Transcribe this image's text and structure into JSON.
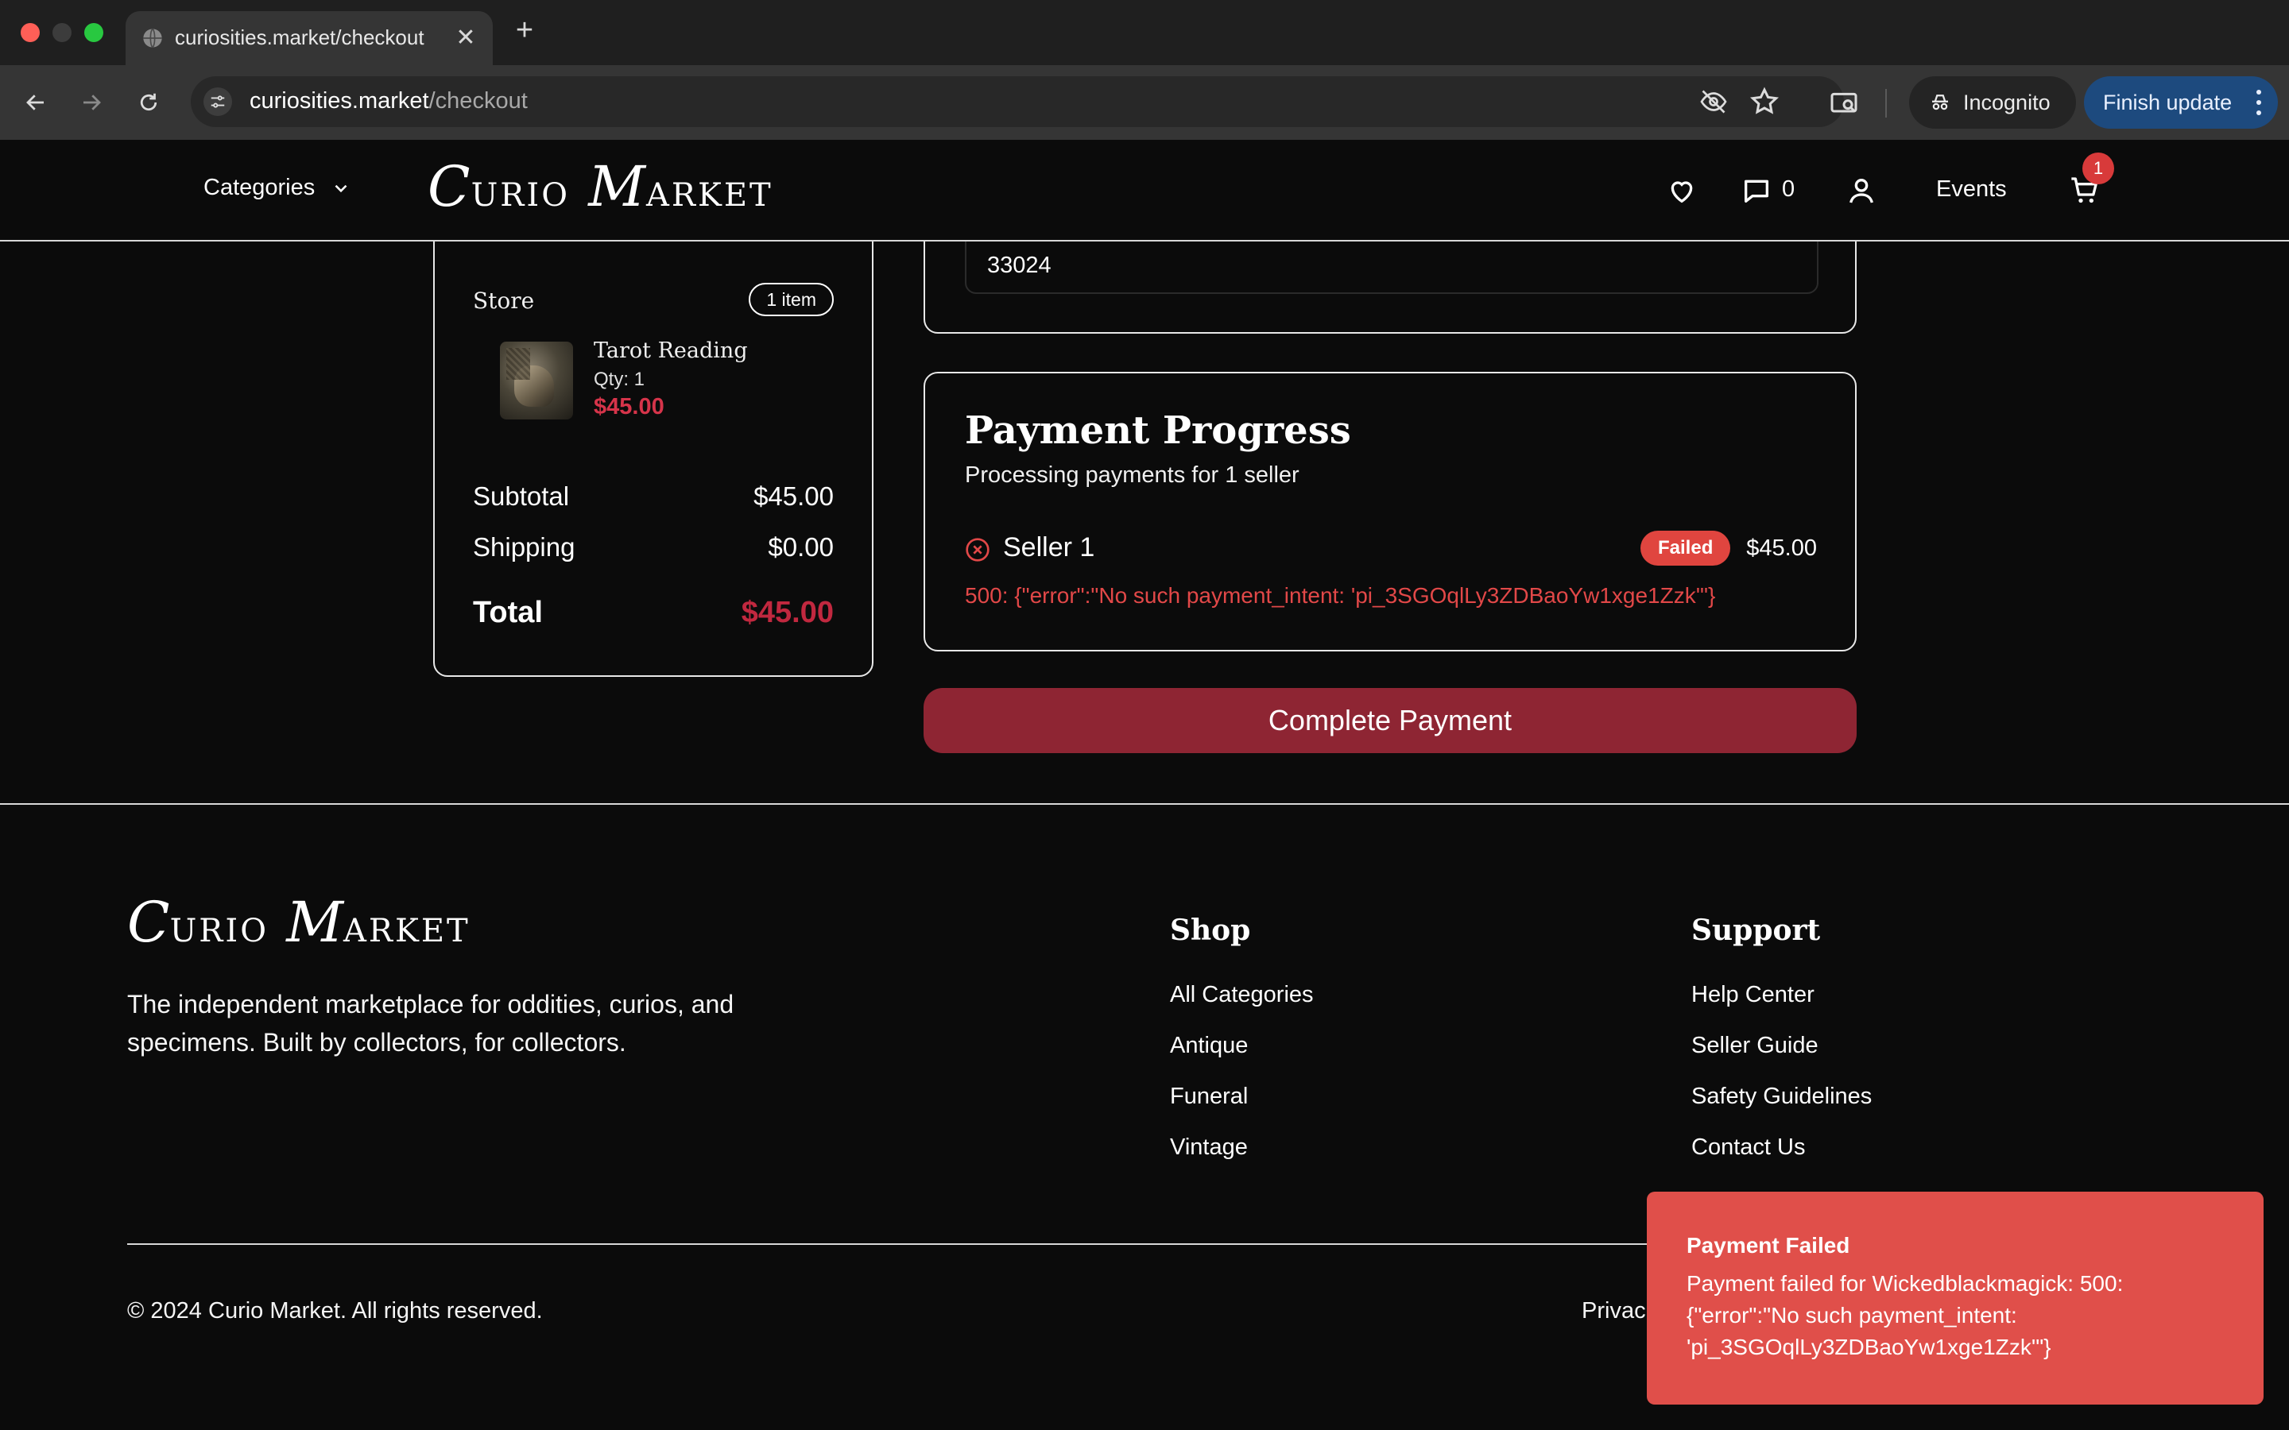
{
  "browser": {
    "tab_title": "curiosities.market/checkout",
    "tab_close": "✕",
    "new_tab": "+",
    "url_host": "curiosities.market",
    "url_path": "/checkout",
    "incognito_label": "Incognito",
    "finish_update_label": "Finish update"
  },
  "header": {
    "categories_label": "Categories",
    "logo_first_initial": "C",
    "logo_first_rest": "URIO",
    "logo_second_initial": "M",
    "logo_second_rest": "ARKET",
    "messages_count": "0",
    "events_label": "Events",
    "cart_count": "1"
  },
  "summary": {
    "store_label": "Store",
    "item_count": "1 item",
    "item": {
      "name": "Tarot Reading",
      "qty": "Qty: 1",
      "price": "$45.00"
    },
    "subtotal_label": "Subtotal",
    "subtotal_value": "$45.00",
    "shipping_label": "Shipping",
    "shipping_value": "$0.00",
    "total_label": "Total",
    "total_value": "$45.00"
  },
  "address": {
    "zip_value": "33024"
  },
  "payment": {
    "title": "Payment Progress",
    "subtitle": "Processing payments for 1 seller",
    "seller_name": "Seller 1",
    "status": "Failed",
    "amount": "$45.00",
    "error": "500: {\"error\":\"No such payment_intent: 'pi_3SGOqlLy3ZDBaoYw1xge1Zzk'\"}",
    "complete_button": "Complete Payment"
  },
  "footer": {
    "logo_first_initial": "C",
    "logo_first_rest": "URIO",
    "logo_second_initial": "M",
    "logo_second_rest": "ARKET",
    "description": "The independent marketplace for oddities, curios, and specimens. Built by collectors, for collectors.",
    "shop_heading": "Shop",
    "shop_links": [
      "All Categories",
      "Antique",
      "Funeral",
      "Vintage"
    ],
    "support_heading": "Support",
    "support_links": [
      "Help Center",
      "Seller Guide",
      "Safety Guidelines",
      "Contact Us"
    ],
    "copyright": "© 2024 Curio Market. All rights reserved.",
    "privacy_partial": "Privac"
  },
  "toast": {
    "title": "Payment Failed",
    "message": "Payment failed for Wickedblackmagick: 500: {\"error\":\"No such payment_intent: 'pi_3SGOqlLy3ZDBaoYw1xge1Zzk'\"}"
  },
  "colors": {
    "accent_red": "#8e2533",
    "price_red": "#c1283f",
    "error_red": "#e24848",
    "toast_bg": "#e04f4a",
    "update_blue": "#1d4a7e"
  },
  "icons": [
    "globe-icon",
    "close-icon",
    "plus-icon",
    "back-arrow-icon",
    "forward-arrow-icon",
    "reload-icon",
    "site-settings-icon",
    "eye-off-icon",
    "star-icon",
    "cast-search-icon",
    "incognito-icon",
    "kebab-menu-icon",
    "chevron-down-icon",
    "heart-icon",
    "chat-icon",
    "user-icon",
    "cart-icon",
    "x-circle-icon"
  ]
}
